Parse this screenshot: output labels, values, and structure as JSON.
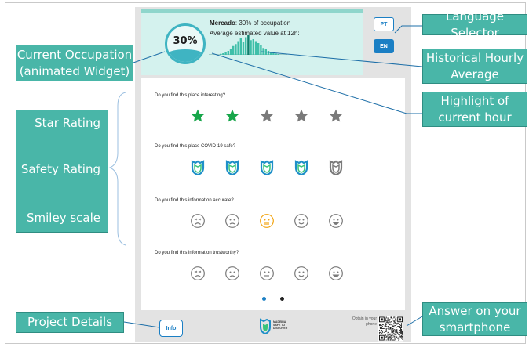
{
  "callouts": {
    "current_occupation": [
      "Current Occupation",
      "(animated Widget)"
    ],
    "language_selector": "Language Selector",
    "historical_hourly": [
      "Historical Hourly",
      "Average"
    ],
    "highlight_current_hour": [
      "Highlight of",
      "current hour"
    ],
    "star_rating": "Star Rating",
    "safety_rating": "Safety Rating",
    "smiley_scale": "Smiley scale",
    "project_details": "Project Details",
    "answer_on_smartphone": [
      "Answer on your",
      "smartphone"
    ]
  },
  "header": {
    "place_name": "Mercado",
    "occupation_text": ": 30% of occupation",
    "average_text": "Average estimated value at 12h:",
    "occupation_value": "30%",
    "occupation_fraction": 0.3
  },
  "hourly_average": [
    0.05,
    0.08,
    0.12,
    0.2,
    0.3,
    0.45,
    0.55,
    0.7,
    0.85,
    0.65,
    0.9,
    1.0,
    0.75,
    0.8,
    0.7,
    0.6,
    0.5,
    0.35,
    0.3,
    0.2,
    0.15,
    0.1,
    0.06,
    0.04
  ],
  "current_hour_index": 11,
  "language": {
    "options": [
      "PT",
      "EN"
    ],
    "selected": "EN"
  },
  "questions": [
    {
      "text": "Do you find this place interesting?",
      "type": "star",
      "options": 5,
      "selected": 2
    },
    {
      "text": "Do you find this place COVID-19 safe?",
      "type": "shield",
      "options": 5,
      "selected": 4
    },
    {
      "text": "Do you find this information accurate?",
      "type": "smiley",
      "options": 5,
      "selected_option": 3
    },
    {
      "text": "Do you find this information trustworthy?",
      "type": "smiley",
      "options": 5,
      "selected_option": 0
    }
  ],
  "pager": {
    "pages": 2,
    "active": 1
  },
  "footer": {
    "info_label": "Info",
    "logo_lines": [
      "MADEIRA",
      "SAFE TO",
      "DISCOVER"
    ],
    "obtain_text": "Obtain in your phone"
  },
  "colors": {
    "accent_teal": "#49b6a8",
    "star_active": "#17a64a",
    "star_inactive": "#7a7a7a",
    "shield_active_outer": "#1e8fc8",
    "shield_active_inner": "#39c47a",
    "shield_inactive": "#7a7a7a",
    "smiley_default": "#7a7a7a",
    "smiley_highlight": "#f2a30f",
    "bar_color": "#3fbfa9",
    "button_blue": "#1b7fc4"
  }
}
